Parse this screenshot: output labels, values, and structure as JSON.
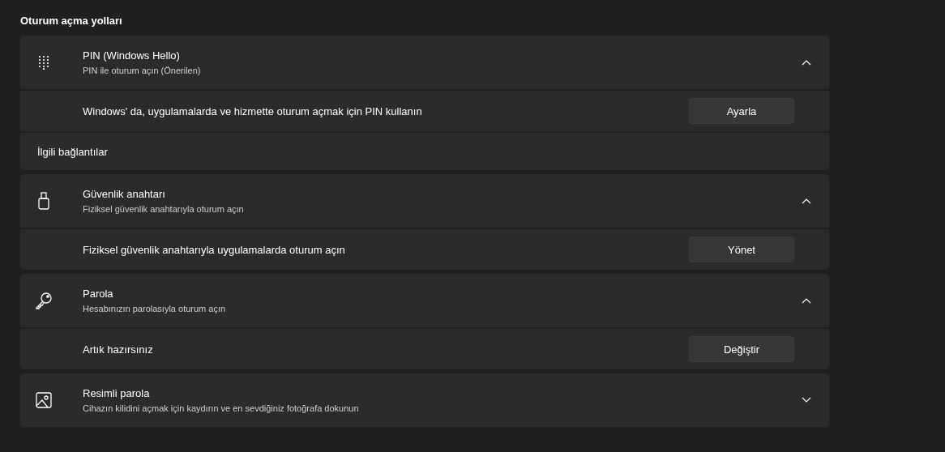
{
  "heading": "Oturum açma yolları",
  "sections": [
    {
      "kind": "pin",
      "title": "PIN (Windows Hello)",
      "subtitle": "PIN ile oturum açın (Önerilen)",
      "expanded": true,
      "rows": [
        {
          "kind": "action",
          "text": "Windows' da, uygulamalarda ve hizmette oturum açmak için PIN kullanın",
          "button": "Ayarla"
        },
        {
          "kind": "links",
          "text": "İlgili bağlantılar"
        }
      ]
    },
    {
      "kind": "security-key",
      "title": "Güvenlik anahtarı",
      "subtitle": "Fiziksel güvenlik anahtarıyla oturum açın",
      "expanded": true,
      "rows": [
        {
          "kind": "action",
          "text": "Fiziksel güvenlik anahtarıyla uygulamalarda oturum açın",
          "button": "Yönet"
        }
      ]
    },
    {
      "kind": "password",
      "title": "Parola",
      "subtitle": "Hesabınızın parolasıyla oturum açın",
      "expanded": true,
      "rows": [
        {
          "kind": "action",
          "text": "Artık hazırsınız",
          "button": "Değiştir"
        }
      ]
    },
    {
      "kind": "picture-password",
      "title": "Resimli parola",
      "subtitle": "Cihazın kilidini açmak için kaydırın ve en sevdiğiniz fotoğrafa dokunun",
      "expanded": false
    }
  ]
}
